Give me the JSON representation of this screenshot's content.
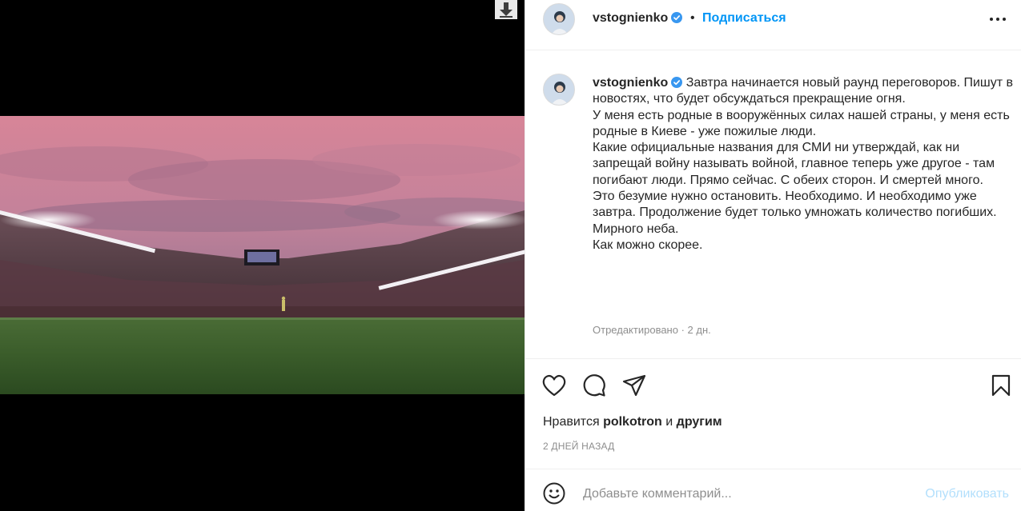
{
  "post": {
    "username": "vstognienko",
    "verified": true,
    "follow_label": "Подписаться",
    "header_separator": "•",
    "caption_text": "Завтра начинается новый раунд переговоров. Пишут в новостях, что будет обсуждаться прекращение огня.\nУ меня есть родные в вооружённых силах нашей страны, у меня есть родные в Киеве - уже пожилые люди.\nКакие официальные названия для СМИ ни утверждай, как ни запрещай войну называть войной, главное теперь уже другое - там погибают люди. Прямо сейчас. С обеих сторон. И смертей много.\nЭто безумие нужно остановить. Необходимо. И необходимо уже завтра. Продолжение будет только умножать количество погибших.\nМирного неба.\nКак можно скорее.",
    "edited_meta": "Отредактировано · 2 дн.",
    "likes_prefix": "Нравится",
    "likes_user": "polkotron",
    "likes_and": "и",
    "likes_others": "другим",
    "timestamp": "2 ДНЕЙ НАЗАД"
  },
  "comment": {
    "placeholder": "Добавьте комментарий...",
    "publish_label": "Опубликовать"
  },
  "colors": {
    "accent": "#0095f6",
    "verified": "#3897f0",
    "muted": "#8e8e8e",
    "publish_disabled": "#b2dffc"
  },
  "icons": {
    "download": "download-icon",
    "more": "more-options-icon",
    "like": "heart-icon",
    "comment": "comment-bubble-icon",
    "share": "paper-plane-icon",
    "save": "bookmark-icon",
    "emoji": "smiley-icon"
  }
}
